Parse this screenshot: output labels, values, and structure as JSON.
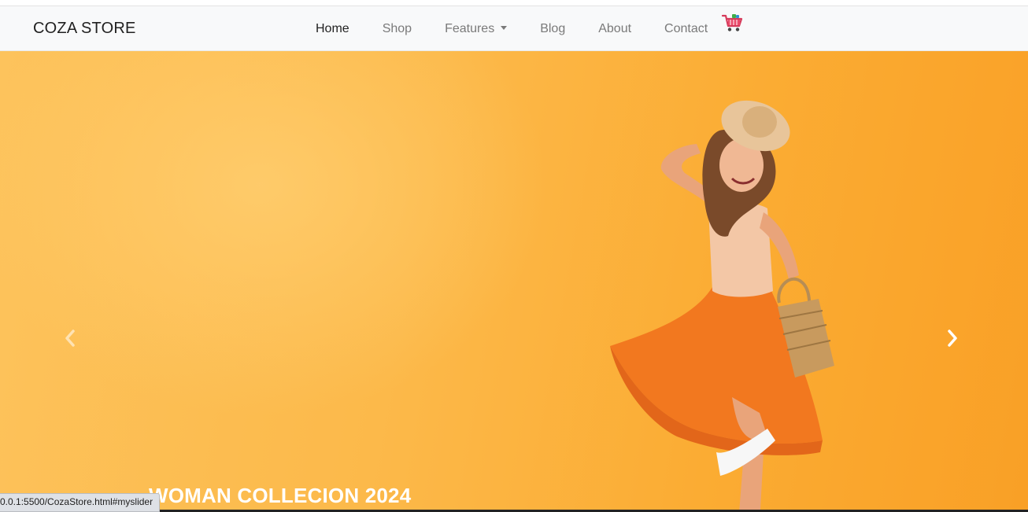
{
  "navbar": {
    "brand": "COZA STORE",
    "links": [
      {
        "label": "Home",
        "active": true
      },
      {
        "label": "Shop"
      },
      {
        "label": "Features"
      },
      {
        "label": "Blog"
      },
      {
        "label": "About"
      },
      {
        "label": "Contact"
      }
    ],
    "cart_icon": "shopping-cart-icon"
  },
  "hero": {
    "caption": "WOMAN COLLECION 2024",
    "prev_icon": "chevron-left-icon",
    "next_icon": "chevron-right-icon",
    "background_color": "#fbb13c"
  },
  "status_bar": {
    "url": "0.0.1:5500/CozaStore.html#myslider"
  }
}
